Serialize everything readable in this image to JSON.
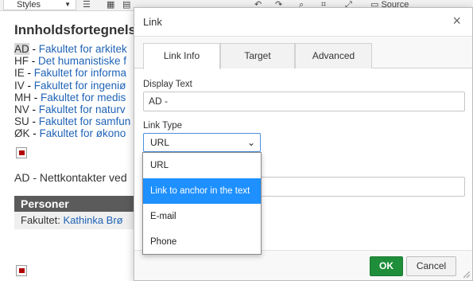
{
  "editor": {
    "toolbar": {
      "styles_label": "Styles",
      "source_label": "Source"
    },
    "heading": "Innholdsfortegnelse",
    "faculties": [
      {
        "code": "AD",
        "sep": " - ",
        "link": "Fakultet for arkitek"
      },
      {
        "code": "HF",
        "sep": " - ",
        "link": "Det humanistiske f"
      },
      {
        "code": "IE",
        "sep": " - ",
        "link": "Fakultet for informa"
      },
      {
        "code": "IV",
        "sep": " - ",
        "link": "Fakultet for ingeniø"
      },
      {
        "code": "MH",
        "sep": " - ",
        "link": "Fakultet for medis"
      },
      {
        "code": "NV",
        "sep": " - ",
        "link": "Fakultet for naturv"
      },
      {
        "code": "SU",
        "sep": " - ",
        "link": "Fakultet for samfun"
      },
      {
        "code": "ØK",
        "sep": " - ",
        "link": "Fakultet for økono"
      }
    ],
    "contact_line": "AD - Nettkontakter ved",
    "table": {
      "header": "Personer",
      "row_label": "Fakultet: ",
      "row_link": "Kathinka Brø"
    }
  },
  "dialog": {
    "title": "Link",
    "close_glyph": "×",
    "tabs": [
      {
        "label": "Link Info",
        "active": true
      },
      {
        "label": "Target",
        "active": false
      },
      {
        "label": "Advanced",
        "active": false
      }
    ],
    "display_text_label": "Display Text",
    "display_text_value": "AD -",
    "link_type_label": "Link Type",
    "link_type_selected": "URL",
    "link_type_options": [
      {
        "label": "URL",
        "selected": false
      },
      {
        "label": "Link to anchor in the text",
        "selected": true
      },
      {
        "label": "E-mail",
        "selected": false
      },
      {
        "label": "Phone",
        "selected": false
      }
    ],
    "ok_label": "OK",
    "cancel_label": "Cancel"
  },
  "colors": {
    "link_blue": "#1f63b6",
    "ok_green": "#1f8e3a",
    "option_highlight": "#1e90ff",
    "flag_red": "#b00000"
  }
}
